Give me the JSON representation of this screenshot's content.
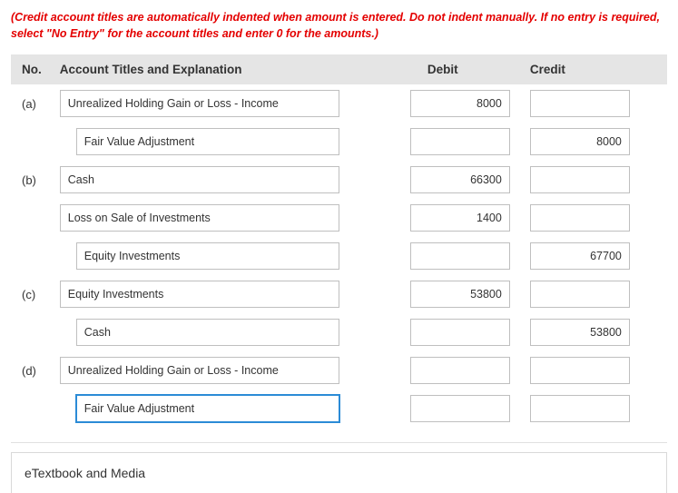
{
  "instruction": "(Credit account titles are automatically indented when amount is entered. Do not indent manually. If no entry is required, select \"No Entry\" for the account titles and enter 0 for the amounts.)",
  "headers": {
    "no": "No.",
    "acct": "Account Titles and Explanation",
    "debit": "Debit",
    "credit": "Credit"
  },
  "rows": [
    {
      "no": "(a)",
      "indent": 0,
      "acct": "Unrealized Holding Gain or Loss - Income",
      "debit": "8000",
      "credit": "",
      "focused": false
    },
    {
      "no": "",
      "indent": 1,
      "acct": "Fair Value Adjustment",
      "debit": "",
      "credit": "8000",
      "focused": false
    },
    {
      "no": "(b)",
      "indent": 0,
      "acct": "Cash",
      "debit": "66300",
      "credit": "",
      "focused": false
    },
    {
      "no": "",
      "indent": 0,
      "acct": "Loss on Sale of Investments",
      "debit": "1400",
      "credit": "",
      "focused": false
    },
    {
      "no": "",
      "indent": 2,
      "acct": "Equity Investments",
      "debit": "",
      "credit": "67700",
      "focused": false
    },
    {
      "no": "(c)",
      "indent": 0,
      "acct": "Equity Investments",
      "debit": "53800",
      "credit": "",
      "focused": false
    },
    {
      "no": "",
      "indent": 2,
      "acct": "Cash",
      "debit": "",
      "credit": "53800",
      "focused": false
    },
    {
      "no": "(d)",
      "indent": 0,
      "acct": "Unrealized Holding Gain or Loss - Income",
      "debit": "",
      "credit": "",
      "focused": false
    },
    {
      "no": "",
      "indent": 1,
      "acct": "Fair Value Adjustment",
      "debit": "",
      "credit": "",
      "focused": true
    }
  ],
  "footer": {
    "etextbook": "eTextbook and Media"
  }
}
